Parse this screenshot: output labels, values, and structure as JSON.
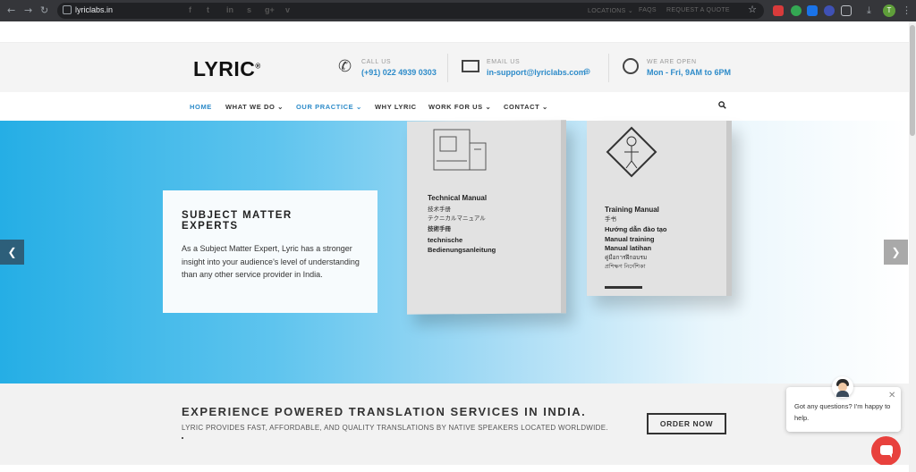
{
  "browser": {
    "url": "lyriclabs.in",
    "profile_initial": "T"
  },
  "topbar": {
    "social": [
      "f",
      "t",
      "in",
      "s",
      "g+",
      "v"
    ],
    "links": [
      "LOCATIONS ⌄",
      "FAQS",
      "REQUEST A QUOTE"
    ]
  },
  "header": {
    "logo": "LYRIC",
    "logo_mark": "®",
    "call": {
      "label": "CALL US",
      "value": "(+91) 022 4939 0303"
    },
    "email": {
      "label": "EMAIL US",
      "value": "in-support@lyriclabs.com"
    },
    "hours": {
      "label": "WE ARE OPEN",
      "value": "Mon - Fri, 9AM to 6PM"
    }
  },
  "nav": {
    "items": [
      {
        "label": "HOME"
      },
      {
        "label": "WHAT WE DO ⌄"
      },
      {
        "label": "OUR PRACTICE ⌄"
      },
      {
        "label": "WHY LYRIC"
      },
      {
        "label": "WORK FOR US ⌄"
      },
      {
        "label": "CONTACT ⌄"
      }
    ],
    "active_index": 0
  },
  "hero": {
    "title": "SUBJECT MATTER EXPERTS",
    "text": "As a Subject Matter Expert, Lyric has a stronger insight into your audience's level of understanding than any other service provider in India.",
    "book1": {
      "title": "Technical Manual",
      "lines": [
        "技术手册",
        "テクニカルマニュアル",
        "技術手冊",
        "technische",
        "Bedienungsanleitung"
      ]
    },
    "book2": {
      "title": "Training Manual",
      "lines": [
        "手书",
        "Hướng dẫn đào tạo",
        "Manual training",
        "Manual latihan",
        "คู่มือการฝึกอบรม",
        "প্রশিক্ষণ নির্দেশিকা"
      ]
    }
  },
  "banner": {
    "title": "EXPERIENCE POWERED TRANSLATION SERVICES IN INDIA.",
    "subtitle": "LYRIC PROVIDES FAST, AFFORDABLE, AND QUALITY TRANSLATIONS BY NATIVE SPEAKERS LOCATED WORLDWIDE.",
    "cta": "ORDER NOW"
  },
  "chat": {
    "message": "Got any questions? I'm happy to help.",
    "close": "✕"
  },
  "colors": {
    "accent": "#2d8bc9",
    "hero_start": "#25aee5",
    "chat_button": "#e8413d"
  }
}
